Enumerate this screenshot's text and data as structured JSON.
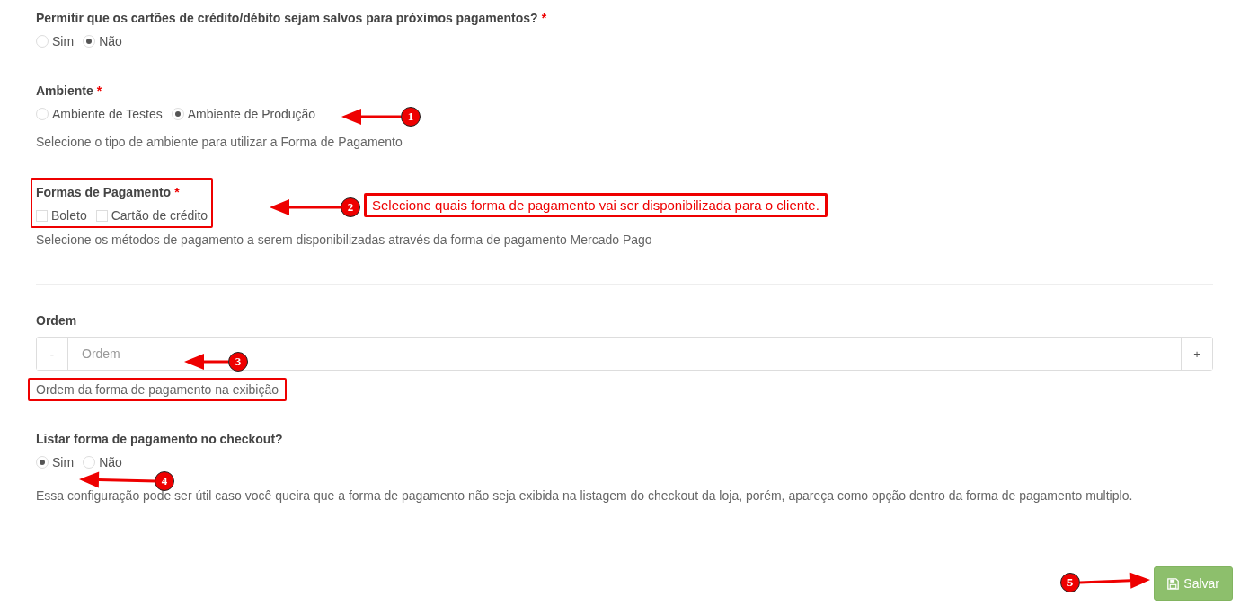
{
  "fields": [
    {
      "kind": "radio",
      "label": "Permitir que os cartões de crédito/débito sejam salvos para próximos pagamentos?",
      "required_mark": "*",
      "options": [
        {
          "label": "Sim",
          "selected": false
        },
        {
          "label": "Não",
          "selected": true
        }
      ]
    },
    {
      "kind": "radio",
      "label": "Ambiente",
      "required_mark": "*",
      "options": [
        {
          "label": "Ambiente de Testes",
          "selected": false
        },
        {
          "label": "Ambiente de Produção",
          "selected": true
        }
      ],
      "help": "Selecione o tipo de ambiente para utilizar a Forma de Pagamento"
    },
    {
      "kind": "checkbox",
      "label": "Formas de Pagamento",
      "required_mark": "*",
      "highlighted": true,
      "options": [
        {
          "label": "Boleto",
          "checked": false
        },
        {
          "label": "Cartão de crédito",
          "checked": false
        }
      ],
      "help": "Selecione os métodos de pagamento a serem disponibilizadas através da forma de pagamento Mercado Pago"
    },
    {
      "kind": "divider"
    },
    {
      "kind": "stepper",
      "label": "Ordem",
      "minus": "-",
      "placeholder": "Ordem",
      "plus": "+",
      "help": "Ordem da forma de pagamento na exibição",
      "help_highlighted": true
    },
    {
      "kind": "radio",
      "label": "Listar forma de pagamento no checkout?",
      "options": [
        {
          "label": "Sim",
          "selected": true
        },
        {
          "label": "Não",
          "selected": false
        }
      ],
      "help": "Essa configuração pode ser útil caso você queira que a forma de pagamento não seja exibida na listagem do checkout da loja, porém, apareça como opção dentro da forma de pagamento multiplo."
    }
  ],
  "save_button": "Salvar",
  "annotations": {
    "markers": [
      "1",
      "2",
      "3",
      "4",
      "5"
    ],
    "callout": "Selecione quais forma de pagamento vai ser disponibilizada para o cliente."
  }
}
